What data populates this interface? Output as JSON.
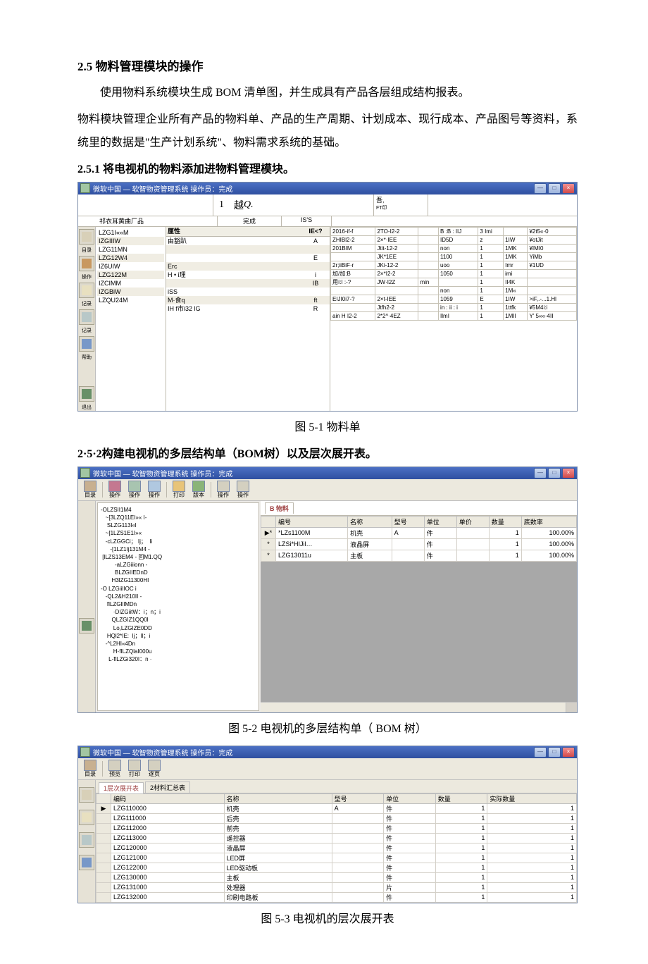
{
  "section_title": "2.5 物料管理模块的操作",
  "para1": "使用物料系统模块生成 BOM 清单图，并生成具有产品各层组成结构报表。",
  "para2": "物料模块管理企业所有产品的物料单、产品的生产周期、计划成本、现行成本、产品图号等资料，系统里的数据是\"生产计划系统\"、物料需求系统的基础。",
  "sub251": "2.5.1 将电视机的物料添加进物料管理模块。",
  "sub252": "2·5·2构建电视机的多层结构单（BOM树）以及层次展开表。",
  "app_title": "微软中国 — 软智物资管理系统 操作员：完成",
  "tab_label": "祁衣耳黄曲厂品",
  "win_btns": {
    "min": "—",
    "max": "□",
    "close": "×"
  },
  "fig1": {
    "caption": "图 5-1 物料单",
    "big_number": "1",
    "big_text": "越",
    "big_q": "Q.",
    "right_top_text_1": "吾,",
    "right_top_text_2": "FT印",
    "status_c": "完成",
    "status_r": "IS'S",
    "list_header": "厘性",
    "list_header_r": "IE<?",
    "left_items": [
      "LZG1I««M",
      "IZGIIIW",
      "LZG11MN",
      "LZG12W4",
      "IZ6UIW",
      "LZG122M",
      "IZCIMM",
      "IZGBiW",
      "LZQU24M"
    ],
    "mid_rows": [
      {
        "a": "由豁趴",
        "b": "A"
      },
      {
        "a": "",
        "b": ""
      },
      {
        "a": "",
        "b": "E"
      },
      {
        "a": "Erc",
        "b": ""
      },
      {
        "a": "H • i理",
        "b": "i"
      },
      {
        "a": "",
        "b": "IB"
      },
      {
        "a": "iSS",
        "b": ""
      },
      {
        "a": "M·食q",
        "b": "ft"
      },
      {
        "a": "IH f市i32 lG",
        "b": "R"
      }
    ],
    "dense": [
      [
        "2016-if-f",
        "2TO-I2-2",
        "",
        "B :B :  IIJ",
        "3 Imi",
        "",
        "¥2t5«·0"
      ],
      [
        "ZHIBl2-2",
        "2×*·IEE",
        "",
        "ID5D",
        "z",
        "1IW",
        "¥otJit"
      ],
      [
        "201BIM",
        "Jtit-12-2",
        "",
        "non",
        "1",
        "1MK",
        "¥IMI0"
      ],
      [
        "",
        "JK*1EE",
        "",
        "1100",
        "1",
        "1MK",
        "YiMb"
      ],
      [
        "2r;iiBiF·r",
        "JKi-12-2",
        "",
        "uoo",
        "1",
        "Imr",
        "¥1UD"
      ],
      [
        "加/加:B",
        "2×*I2-2",
        "",
        "1050",
        "1",
        "imi",
        ""
      ],
      [
        "用í:I :-?",
        "JW·I2Z",
        "min",
        "",
        "1",
        "II4K",
        ""
      ],
      [
        "",
        "",
        "",
        "non",
        "1",
        "1M«",
        ""
      ],
      [
        "EIJI0i7-?",
        "2×t-IEE",
        "",
        "1059",
        "E",
        "1IW",
        ">iF,.-...1.Hl"
      ],
      [
        "",
        "Jtfh2-2",
        "",
        "in : ii : i",
        "1",
        "1ttfk",
        "¥5M4i:i"
      ],
      [
        "ain H I2-2",
        "2*2^·4EZ",
        "",
        "IlmI",
        "1",
        "1MII",
        "Y' 5««·4II"
      ]
    ],
    "sidebar_labels": [
      "目录",
      "操作",
      "记录",
      "记录",
      "帮助",
      "退出"
    ],
    "exit_label": "退出"
  },
  "fig2": {
    "caption": "图 5-2 电视机的多层结构单（ BOM 树）",
    "tree_tab": "B 物料",
    "tree_lines": [
      "-OLZSII1M4",
      "   ~[3LZQ11EI»« I-",
      "    SLZG113l«l",
      "",
      "   ~[1LZS1E1I»«",
      "",
      "   -cLZGGCi； Ij；  Ii",
      "      -[1LZ1Ij131M4 -",
      " [lLZS13EM4 - 回M1.QQ",
      "         -aLZGiiionn -",
      "         BLZGIIEDnD",
      "       H3lZG11300HI",
      "-O LZGiiIIOC i",
      "",
      "   -QL2&H210II -",
      "    flLZGIllMDn",
      "        ·DIZGiitW：i；n；i",
      "       QLZGIZ1QQ0l",
      "        Lo,LZGIZE0DD",
      "    HQl2*IE:  Ij；Il；i",
      "",
      "   -^L2HI«4Dn",
      "        H-fILZQlaI000u",
      "     L-flLZGi320I：n ·"
    ],
    "grid_headers": [
      "",
      "编号",
      "名称",
      "型号",
      "单位",
      "单价",
      "数量",
      "底数率"
    ],
    "grid_rows": [
      {
        "marker": "▶*",
        "code": "*LZs1100M",
        "name": "机壳",
        "model": "A",
        "unit": "件",
        "price": "",
        "qty": "1",
        "rate": "100.00%"
      },
      {
        "marker": "*",
        "code": "LZSi*HIJil…",
        "name": "液晶屏",
        "model": "",
        "unit": "件",
        "price": "",
        "qty": "1",
        "rate": "100.00%"
      },
      {
        "marker": "*",
        "code": "LZG13011u",
        "name": "主板",
        "model": "",
        "unit": "件",
        "price": "",
        "qty": "1",
        "rate": "100.00%"
      }
    ]
  },
  "fig3": {
    "caption": "图 5-3 电视机的层次展开表",
    "tab1": "1层次展开表",
    "tab2": "2材料汇总表",
    "headers": [
      "",
      "编码",
      "名称",
      "型号",
      "单位",
      "数量",
      "实际数量"
    ],
    "rows": [
      {
        "code": "LZG110000",
        "name": "机壳",
        "model": "A",
        "unit": "件",
        "qty": "1",
        "aqty": "1"
      },
      {
        "code": "LZG111000",
        "name": "后壳",
        "model": "",
        "unit": "件",
        "qty": "1",
        "aqty": "1"
      },
      {
        "code": "LZG112000",
        "name": "前壳",
        "model": "",
        "unit": "件",
        "qty": "1",
        "aqty": "1"
      },
      {
        "code": "LZG113000",
        "name": "遥控器",
        "model": "",
        "unit": "件",
        "qty": "1",
        "aqty": "1"
      },
      {
        "code": "LZG120000",
        "name": "液晶屏",
        "model": "",
        "unit": "件",
        "qty": "1",
        "aqty": "1"
      },
      {
        "code": "LZG121000",
        "name": "LED屏",
        "model": "",
        "unit": "件",
        "qty": "1",
        "aqty": "1"
      },
      {
        "code": "LZG122000",
        "name": "LED驱动板",
        "model": "",
        "unit": "件",
        "qty": "1",
        "aqty": "1"
      },
      {
        "code": "LZG130000",
        "name": "主板",
        "model": "",
        "unit": "件",
        "qty": "1",
        "aqty": "1"
      },
      {
        "code": "LZG131000",
        "name": "处理器",
        "model": "",
        "unit": "片",
        "qty": "1",
        "aqty": "1"
      },
      {
        "code": "LZG132000",
        "name": "印刷电路板",
        "model": "",
        "unit": "件",
        "qty": "1",
        "aqty": "1"
      }
    ]
  }
}
